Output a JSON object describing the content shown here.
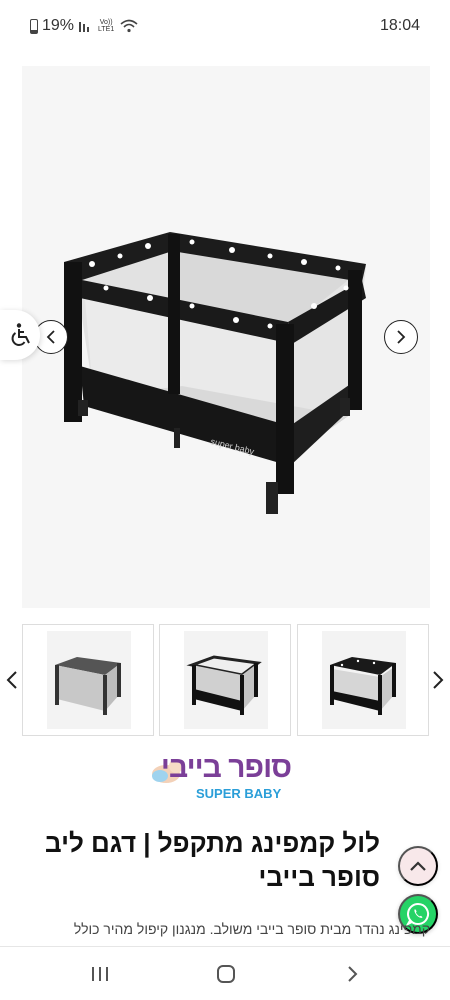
{
  "status_bar": {
    "battery": "19%",
    "network_top": "Vo))",
    "network_bottom": "LTE1",
    "time": "18:04"
  },
  "gallery": {
    "main_image_alt": "Black foldable playpen with white stars",
    "thumbnails": [
      {
        "label": "Grey playpen"
      },
      {
        "label": "Black playpen with white print"
      },
      {
        "label": "Black playpen with stars"
      }
    ]
  },
  "logo": {
    "hebrew": "סופר בייבי",
    "english": "SUPER BABY"
  },
  "product": {
    "title": "לול קמפינג מתקפל | דגם ליב סופר בייבי",
    "description": "קמפינג נהדר מבית סופר בייבי משולב. מנגנון קיפול מהיר כולל"
  },
  "colors": {
    "accent": "#7b3f98",
    "logo_blue": "#2a9ed8",
    "whatsapp": "#25d366",
    "scroll_top_bg": "#f8e8ea"
  },
  "icons": {
    "prev": "chevron-left-icon",
    "next": "chevron-right-icon",
    "accessibility": "wheelchair-icon",
    "scroll_top": "chevron-up-icon",
    "whatsapp": "whatsapp-icon",
    "nav_recent": "recent-apps-icon",
    "nav_home": "home-icon",
    "nav_back": "back-icon"
  }
}
